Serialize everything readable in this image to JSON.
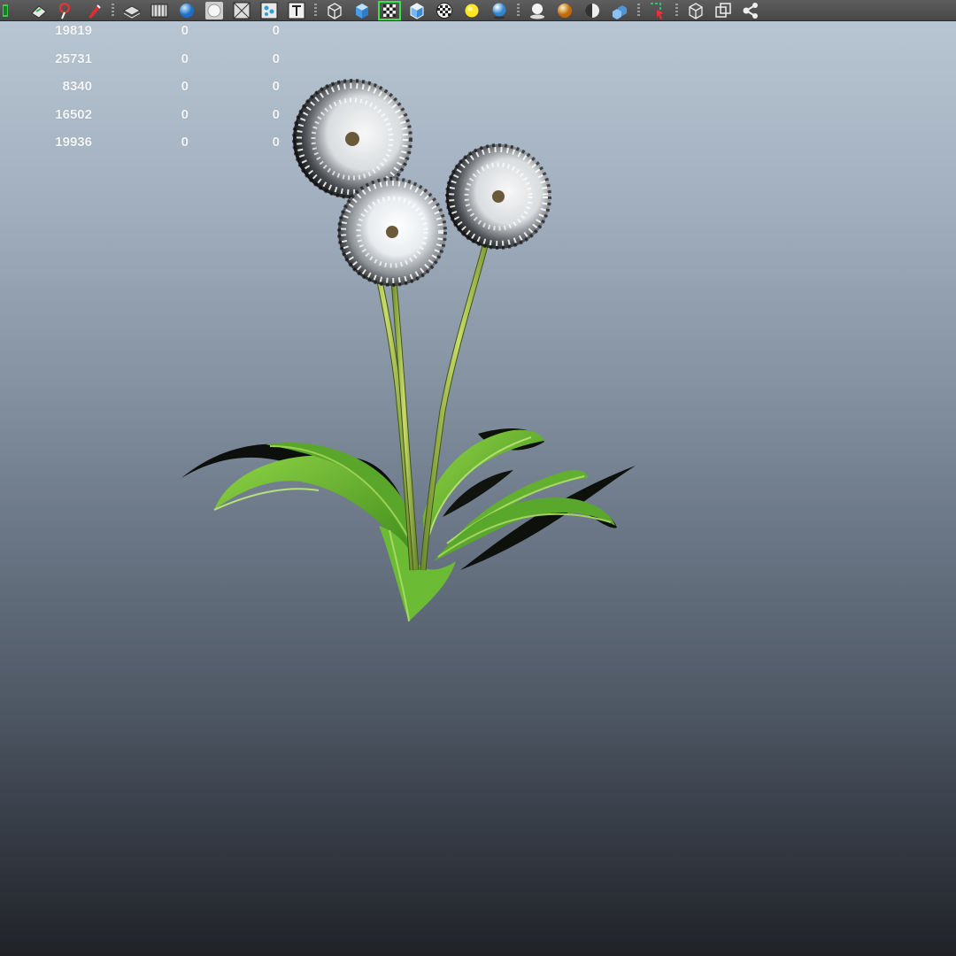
{
  "toolbar": {
    "icons": [
      "paint-icon",
      "select-tool-icon",
      "lasso-icon",
      "brush-icon",
      "layers-icon",
      "film-strip-icon",
      "sphere-icon",
      "circle-icon",
      "grid-icon",
      "particles-icon",
      "text-icon",
      "wire-cube-icon",
      "solid-cube-icon",
      "checker-cube-icon",
      "shaded-cube-icon",
      "checker-ball-icon",
      "light-bulb-icon",
      "blue-sphere-icon",
      "spot-light-icon",
      "material-sphere-icon",
      "half-sphere-icon",
      "cubes-icon",
      "pick-icon",
      "box-icon",
      "overlap-icon",
      "share-nodes-icon"
    ],
    "active_icon": "checker-cube-icon"
  },
  "hud": {
    "rows": [
      [
        "19819",
        "0",
        "0"
      ],
      [
        "25731",
        "0",
        "0"
      ],
      [
        "8340",
        "0",
        "0"
      ],
      [
        "16502",
        "0",
        "0"
      ],
      [
        "19936",
        "0",
        "0"
      ]
    ]
  },
  "viewport": {
    "gradient_top": "#b8c6d3",
    "gradient_bottom": "#202227"
  }
}
